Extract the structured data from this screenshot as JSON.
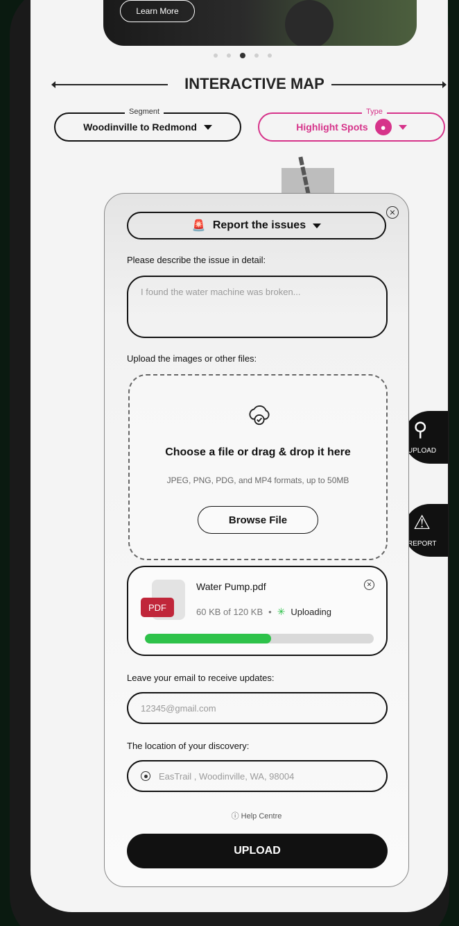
{
  "hero": {
    "learn_more": "Learn More"
  },
  "carousel": {
    "total": 5,
    "active_index": 3
  },
  "map": {
    "title": "INTERACTIVE MAP",
    "segment": {
      "legend": "Segment",
      "value": "Woodinville to Redmond"
    },
    "type": {
      "legend": "Type",
      "value": "Highlight Spots"
    }
  },
  "fabs": {
    "upload_label": "UPLOAD",
    "report_label": "REPORT"
  },
  "modal": {
    "report_dropdown": "Report the issues",
    "describe_label": "Please describe the issue in detail:",
    "describe_placeholder": "I found the water machine was broken...",
    "upload_label": "Upload the images or other files:",
    "dropzone_title": "Choose a file or drag & drop it here",
    "dropzone_sub": "JPEG, PNG, PDG, and MP4 formats, up to 50MB",
    "browse_button": "Browse File",
    "file": {
      "badge": "PDF",
      "name": "Water Pump.pdf",
      "size_progress": "60 KB of 120 KB",
      "separator": "•",
      "status": "Uploading",
      "progress": 0.55
    },
    "email_label": "Leave your email to receive updates:",
    "email_value": "12345@gmail.com",
    "location_label": "The location of your discovery:",
    "location_value": "EasTrail , Woodinville, WA, 98004",
    "help": "Help Centre",
    "upload_button": "UPLOAD"
  },
  "colors": {
    "accent": "#d6338a",
    "progress": "#2ec24a",
    "pdf": "#c0263a"
  }
}
